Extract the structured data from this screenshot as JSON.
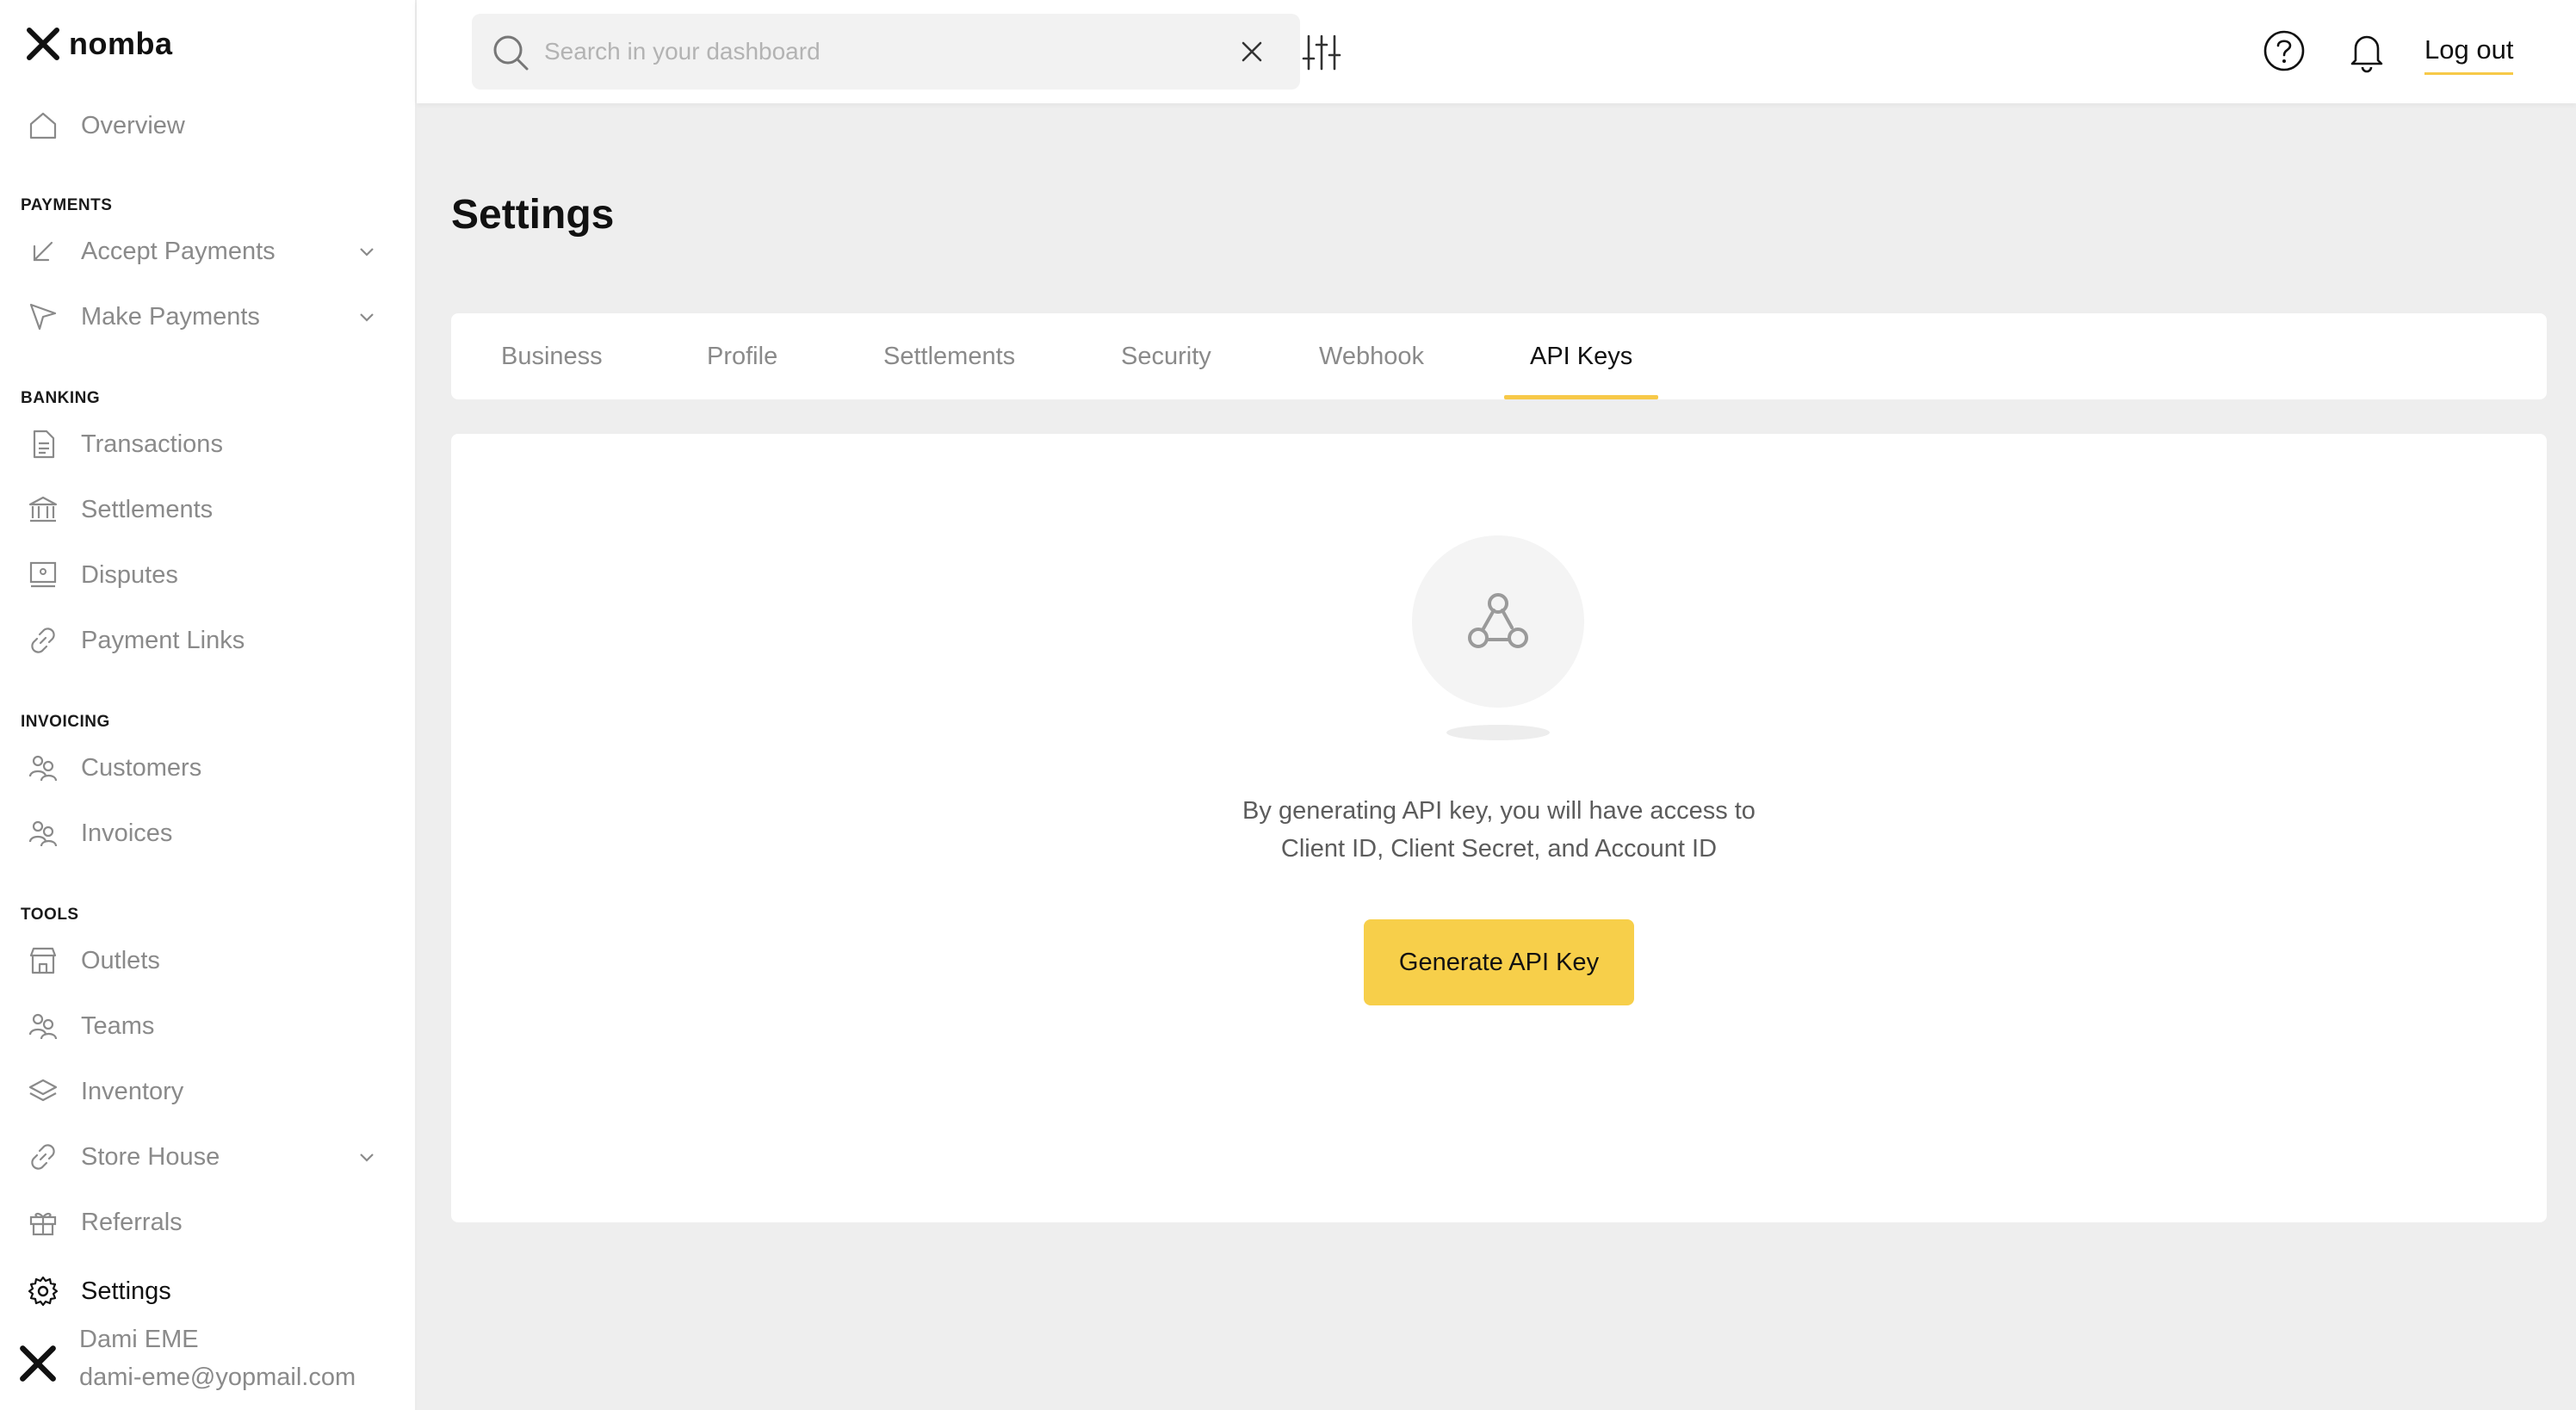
{
  "brand": {
    "name": "nomba",
    "accent": "#f7c948"
  },
  "sidebar": {
    "overview": "Overview",
    "sections": {
      "payments": "PAYMENTS",
      "banking": "BANKING",
      "invoicing": "INVOICING",
      "tools": "TOOLS"
    },
    "items": {
      "accept_payments": "Accept Payments",
      "make_payments": "Make Payments",
      "transactions": "Transactions",
      "settlements": "Settlements",
      "disputes": "Disputes",
      "payment_links": "Payment Links",
      "customers": "Customers",
      "invoices": "Invoices",
      "outlets": "Outlets",
      "teams": "Teams",
      "inventory": "Inventory",
      "store_house": "Store House",
      "referrals": "Referrals",
      "settings": "Settings"
    },
    "user": {
      "name": "Dami EME",
      "email": "dami-eme@yopmail.com"
    }
  },
  "topbar": {
    "search_placeholder": "Search in your dashboard",
    "logout": "Log out"
  },
  "main": {
    "title": "Settings",
    "tabs": [
      "Business",
      "Profile",
      "Settlements",
      "Security",
      "Webhook",
      "API Keys"
    ],
    "active_tab": "API Keys",
    "empty_text_line1": "By generating API key, you will have access to",
    "empty_text_line2": "Client ID, Client Secret, and Account ID",
    "generate_button": "Generate API Key"
  }
}
